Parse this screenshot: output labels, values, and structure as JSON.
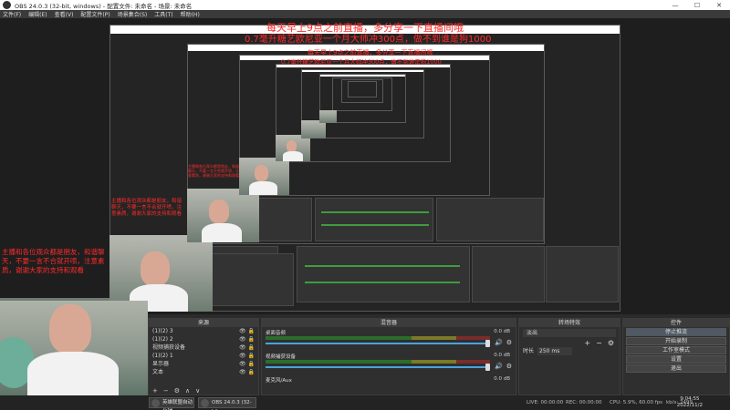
{
  "window": {
    "title": "OBS 24.0.3 (32-bit, windows) - 配置文件: 未命名 - 场景: 未命名",
    "controls": [
      "—",
      "☐",
      "✕"
    ]
  },
  "menu": [
    "文件(F)",
    "编辑(E)",
    "查看(V)",
    "配置文件(P)",
    "场景集合(S)",
    "工具(T)",
    "帮助(H)"
  ],
  "overlay": {
    "line1": "每天早上9点之前直播，多分享一下直播间哦",
    "line2": "0.7毫升糖艺欧尼亚一个月大师冲300点，做不到谁是狗1000",
    "line3": "每天早上9点之前直播，多分享一下直播间哦",
    "line4": "0.7毫升糖艺欧尼亚一个月大师冲300点，做不到谁是狗1000",
    "left_block": "主播和各位观众都是朋友，和谐聊天，不要一言不合就开喷，注意素质，谢谢大家的支持和观看"
  },
  "docks": {
    "scenes": {
      "header": "场景",
      "items": [
        "场景"
      ]
    },
    "sources": {
      "header": "来源",
      "items": [
        "(1)(2) 3",
        "(1)(2) 2",
        "视频捕获设备",
        "(1)(2) 1",
        "显示器",
        "文本"
      ]
    },
    "mixer": {
      "header": "混音器",
      "channels": [
        {
          "label": "桌面音频",
          "db": "0.0 dB"
        },
        {
          "label": "麦克风/Aux",
          "db": "0.0 dB"
        },
        {
          "label": "视频捕获设备",
          "db": "0.0 dB"
        }
      ]
    },
    "transitions": {
      "header": "转场特效",
      "type": "淡出",
      "duration_label": "时长",
      "duration_value": "250 ms"
    },
    "controls": {
      "header": "控件",
      "buttons": [
        "停止推流",
        "开始录制",
        "工作室模式",
        "设置",
        "退出"
      ]
    }
  },
  "status": {
    "live": "LIVE: 00:00:00",
    "rec": "REC: 00:00:00",
    "cpu": "CPU: 5.9%, 60.00 fps",
    "kbps": "kb/s: 2499"
  },
  "taskbar": {
    "app1": "英雄联盟自动化辅...",
    "app2": "OBS 24.0.3 (32-bit...",
    "time": "9:04:55",
    "date": "2022/11/2"
  }
}
